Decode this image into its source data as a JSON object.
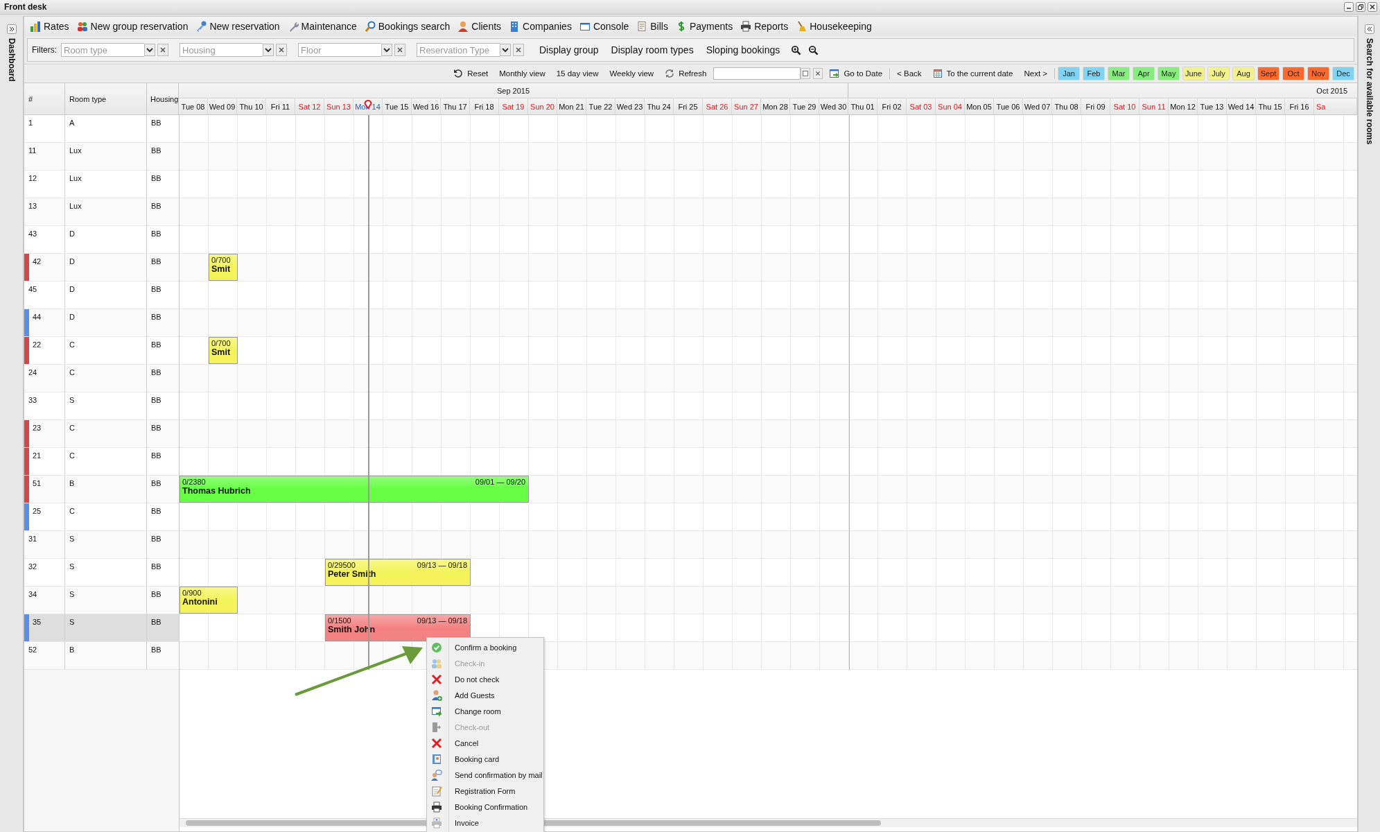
{
  "window": {
    "title": "Front desk"
  },
  "left_panel": {
    "title": "Dashboard"
  },
  "right_panel": {
    "title": "Search for available rooms"
  },
  "toolbar": [
    {
      "label": "Rates"
    },
    {
      "label": "New group reservation"
    },
    {
      "label": "New reservation"
    },
    {
      "label": "Maintenance"
    },
    {
      "label": "Bookings search"
    },
    {
      "label": "Clients"
    },
    {
      "label": "Companies"
    },
    {
      "label": "Console"
    },
    {
      "label": "Bills"
    },
    {
      "label": "Payments"
    },
    {
      "label": "Reports"
    },
    {
      "label": "Housekeeping"
    }
  ],
  "filters": {
    "label": "Filters:",
    "fields": [
      {
        "placeholder": "Room type"
      },
      {
        "placeholder": "Housing"
      },
      {
        "placeholder": "Floor"
      },
      {
        "placeholder": "Reservation Type"
      }
    ],
    "buttons": [
      "Display group",
      "Display room types",
      "Sloping bookings"
    ]
  },
  "nav": {
    "views": [
      {
        "label": "Reset"
      },
      {
        "label": "Monthly view"
      },
      {
        "label": "15 day view"
      },
      {
        "label": "Weekly view"
      },
      {
        "label": "Refresh"
      }
    ],
    "actions": [
      {
        "label": "Go to Date"
      },
      {
        "label": "< Back"
      },
      {
        "label": "To the current date"
      },
      {
        "label": "Next >"
      }
    ],
    "months": [
      {
        "label": "Jan",
        "color": "#7fd3f5"
      },
      {
        "label": "Feb",
        "color": "#7fd3f5"
      },
      {
        "label": "Mar",
        "color": "#85ee7c"
      },
      {
        "label": "Apr",
        "color": "#85ee7c"
      },
      {
        "label": "May",
        "color": "#85ee7c"
      },
      {
        "label": "June",
        "color": "#f3f38a"
      },
      {
        "label": "July",
        "color": "#f3f38a"
      },
      {
        "label": "Aug",
        "color": "#f3f38a"
      },
      {
        "label": "Sept",
        "color": "#ff6a2c"
      },
      {
        "label": "Oct",
        "color": "#ff6a2c"
      },
      {
        "label": "Nov",
        "color": "#ff6a2c"
      },
      {
        "label": "Dec",
        "color": "#7fd3f5"
      }
    ]
  },
  "grid": {
    "columns": [
      "#",
      "Room type",
      "Housing"
    ],
    "months": [
      {
        "label": "Sep 2015",
        "days": [
          {
            "label": "Tue 08",
            "kind": "weekday"
          },
          {
            "label": "Wed 09",
            "kind": "weekday"
          },
          {
            "label": "Thu 10",
            "kind": "weekday"
          },
          {
            "label": "Fri 11",
            "kind": "weekday"
          },
          {
            "label": "Sat 12",
            "kind": "weekend"
          },
          {
            "label": "Sun 13",
            "kind": "weekend"
          },
          {
            "label": "Mon 14",
            "kind": "today"
          },
          {
            "label": "Tue 15",
            "kind": "weekday"
          },
          {
            "label": "Wed 16",
            "kind": "weekday"
          },
          {
            "label": "Thu 17",
            "kind": "weekday"
          },
          {
            "label": "Fri 18",
            "kind": "weekday"
          },
          {
            "label": "Sat 19",
            "kind": "weekend"
          },
          {
            "label": "Sun 20",
            "kind": "weekend"
          },
          {
            "label": "Mon 21",
            "kind": "weekday"
          },
          {
            "label": "Tue 22",
            "kind": "weekday"
          },
          {
            "label": "Wed 23",
            "kind": "weekday"
          },
          {
            "label": "Thu 24",
            "kind": "weekday"
          },
          {
            "label": "Fri 25",
            "kind": "weekday"
          },
          {
            "label": "Sat 26",
            "kind": "weekend"
          },
          {
            "label": "Sun 27",
            "kind": "weekend"
          },
          {
            "label": "Mon 28",
            "kind": "weekday"
          },
          {
            "label": "Tue 29",
            "kind": "weekday"
          },
          {
            "label": "Wed 30",
            "kind": "weekday"
          }
        ]
      },
      {
        "label": "Oct 2015",
        "days": [
          {
            "label": "Thu 01",
            "kind": "weekday"
          },
          {
            "label": "Fri 02",
            "kind": "weekday"
          },
          {
            "label": "Sat 03",
            "kind": "weekend"
          },
          {
            "label": "Sun 04",
            "kind": "weekend"
          },
          {
            "label": "Mon 05",
            "kind": "weekday"
          },
          {
            "label": "Tue 06",
            "kind": "weekday"
          },
          {
            "label": "Wed 07",
            "kind": "weekday"
          },
          {
            "label": "Thu 08",
            "kind": "weekday"
          },
          {
            "label": "Fri 09",
            "kind": "weekday"
          },
          {
            "label": "Sat 10",
            "kind": "weekend"
          },
          {
            "label": "Sun 11",
            "kind": "weekend"
          },
          {
            "label": "Mon 12",
            "kind": "weekday"
          },
          {
            "label": "Tue 13",
            "kind": "weekday"
          },
          {
            "label": "Wed 14",
            "kind": "weekday"
          },
          {
            "label": "Thu 15",
            "kind": "weekday"
          },
          {
            "label": "Fri 16",
            "kind": "weekday"
          },
          {
            "label": "Sa",
            "kind": "weekend"
          }
        ]
      }
    ],
    "rows": [
      {
        "number": "1",
        "room_type": "A",
        "housing": "BB",
        "selected": false
      },
      {
        "number": "11",
        "room_type": "Lux",
        "housing": "BB",
        "selected": false
      },
      {
        "number": "12",
        "room_type": "Lux",
        "housing": "BB",
        "selected": false
      },
      {
        "number": "13",
        "room_type": "Lux",
        "housing": "BB",
        "selected": false
      },
      {
        "number": "43",
        "room_type": "D",
        "housing": "BB",
        "selected": false
      },
      {
        "number": "42",
        "room_type": "D",
        "housing": "BB",
        "selected": false,
        "color": "#d04848",
        "bookings": [
          {
            "amount": "0/700",
            "guest": "Smit",
            "color": "#f4f45a"
          }
        ]
      },
      {
        "number": "45",
        "room_type": "D",
        "housing": "BB",
        "selected": false
      },
      {
        "number": "44",
        "room_type": "D",
        "housing": "BB",
        "selected": false,
        "color": "#5b8fe6"
      },
      {
        "number": "22",
        "room_type": "C",
        "housing": "BB",
        "selected": false,
        "color": "#d04848",
        "bookings": [
          {
            "amount": "0/700",
            "guest": "Smit",
            "color": "#f4f45a"
          }
        ]
      },
      {
        "number": "24",
        "room_type": "C",
        "housing": "BB",
        "selected": false
      },
      {
        "number": "33",
        "room_type": "S",
        "housing": "BB",
        "selected": false
      },
      {
        "number": "23",
        "room_type": "C",
        "housing": "BB",
        "selected": false,
        "color": "#d04848"
      },
      {
        "number": "21",
        "room_type": "C",
        "housing": "BB",
        "selected": false,
        "color": "#d04848"
      },
      {
        "number": "51",
        "room_type": "B",
        "housing": "BB",
        "selected": false,
        "color": "#d04848",
        "bookings": [
          {
            "amount": "0/2380",
            "guest": "Thomas Hubrich",
            "dates": "09/01 — 09/20",
            "color": "#66ff44"
          }
        ]
      },
      {
        "number": "25",
        "room_type": "C",
        "housing": "BB",
        "selected": false,
        "color": "#5b8fe6"
      },
      {
        "number": "31",
        "room_type": "S",
        "housing": "BB",
        "selected": false
      },
      {
        "number": "32",
        "room_type": "S",
        "housing": "BB",
        "selected": false,
        "bookings": [
          {
            "amount": "0/29500",
            "guest": "Peter Smith",
            "dates": "09/13 — 09/18",
            "color": "#f4f45a"
          }
        ]
      },
      {
        "number": "34",
        "room_type": "S",
        "housing": "BB",
        "selected": false,
        "bookings": [
          {
            "amount": "0/900",
            "guest": "Antonini",
            "color": "#f4f45a"
          }
        ]
      },
      {
        "number": "35",
        "room_type": "S",
        "housing": "BB",
        "selected": true,
        "color": "#5b8fe6",
        "bookings": [
          {
            "amount": "0/1500",
            "guest": "Smith John",
            "dates": "09/13 — 09/18",
            "color": "#f58282"
          }
        ]
      },
      {
        "number": "52",
        "room_type": "B",
        "housing": "BB",
        "selected": false
      }
    ]
  },
  "context_menu": {
    "items": [
      {
        "label": "Confirm a booking",
        "disabled": false
      },
      {
        "label": "Check-in",
        "disabled": true
      },
      {
        "label": "Do not check",
        "disabled": false
      },
      {
        "label": "Add Guests",
        "disabled": false
      },
      {
        "label": "Change room",
        "disabled": false
      },
      {
        "label": "Check-out",
        "disabled": true
      },
      {
        "label": "Cancel",
        "disabled": false
      },
      {
        "label": "Booking card",
        "disabled": false
      },
      {
        "label": "Send confirmation by mail",
        "disabled": false
      },
      {
        "label": "Registration Form",
        "disabled": false
      },
      {
        "label": "Booking Confirmation",
        "disabled": false
      },
      {
        "label": "Invoice",
        "disabled": false
      }
    ]
  }
}
